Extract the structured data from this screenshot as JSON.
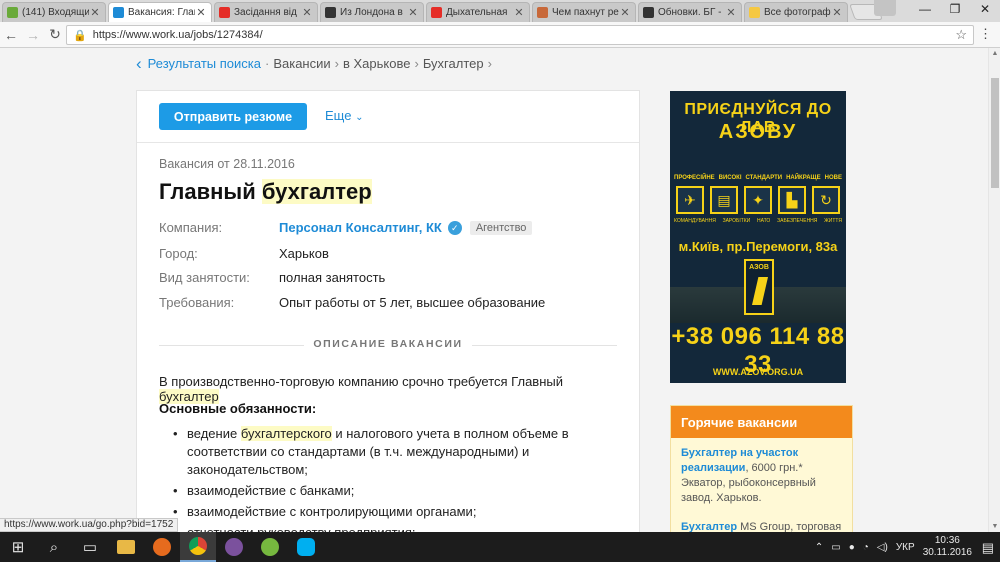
{
  "browser": {
    "tabs": [
      {
        "title": "(141) Входящи",
        "color": "#6aaa3a",
        "active": false
      },
      {
        "title": "Вакансия: Глав",
        "color": "#1e8bd6",
        "active": true
      },
      {
        "title": "Засідання від",
        "color": "#e52d27",
        "active": false
      },
      {
        "title": "Из Лондона в",
        "color": "#333333",
        "active": false
      },
      {
        "title": "Дыхательная",
        "color": "#e52d27",
        "active": false
      },
      {
        "title": "Чем пахнут ре",
        "color": "#c8693a",
        "active": false
      },
      {
        "title": "Обновки. БГ -",
        "color": "#333333",
        "active": false
      },
      {
        "title": "Все фотограф",
        "color": "#f5c842",
        "active": false
      }
    ],
    "url": "https://www.work.ua/jobs/1274384/"
  },
  "breadcrumb": {
    "items": [
      "Результаты поиска",
      "Вакансии",
      "в Харькове",
      "Бухгалтер"
    ]
  },
  "actions": {
    "send_resume": "Отправить резюме",
    "more": "Еще"
  },
  "vacancy": {
    "date": "Вакансия от 28.11.2016",
    "title_part1": "Главный ",
    "title_part2": "бухгалтер",
    "company_label": "Компания:",
    "company": "Персонал Консалтинг, КК",
    "agency_badge": "Агентство",
    "city_label": "Город:",
    "city": "Харьков",
    "employment_label": "Вид занятости:",
    "employment": "полная занятость",
    "requirements_label": "Требования:",
    "requirements": "Опыт работы от 5 лет, высшее образование",
    "section_title": "ОПИСАНИЕ ВАКАНСИИ",
    "intro_part1": "В производственно-торговую компанию срочно требуется Главный ",
    "intro_part2": "бухгалтер",
    "duties_title": "Основные обязанности:",
    "duty1_part1": "ведение ",
    "duty1_part2": "бухгалтерского",
    "duty1_part3": " и налогового учета в полном объеме в соответствии со стандартами (в т.ч. международными) и законодательством;",
    "duty2": "взаимодействие с банками;",
    "duty3": "взаимодействие с контролирующими органами;",
    "duty4": "отчетности руководству предприятия;"
  },
  "ad": {
    "line1": "ПРИЄДНУЙСЯ ДО ЛАВ",
    "line2": "АЗОВУ",
    "captions_top": [
      "ПРОФЕСІЙНЕ",
      "ВИСОКІ",
      "СТАНДАРТИ",
      "НАЙКРАЩЕ",
      "НОВЕ"
    ],
    "captions_bottom": [
      "КОМАНДУВАННЯ",
      "ЗАРОБІТКИ",
      "НАТО",
      "ЗАБЕЗПЕЧЕННЯ",
      "ЖИТТЯ"
    ],
    "address": "м.Київ, пр.Перемоги, 83а",
    "emblem": "АЗОВ",
    "phone": "+38 096 114 88 33",
    "site": "WWW.AZOV.ORG.UA"
  },
  "hot_vacancies": {
    "title": "Горячие вакансии",
    "item1_link": "Бухгалтер на участок реализации",
    "item1_text": ", 6000 грн.* Экватор, рыбоконсервный завод. Харьков.",
    "item2_link": "Бухгалтер",
    "item2_text": " MS Group, торговая"
  },
  "status_bar": "https://www.work.ua/go.php?bid=1752",
  "taskbar": {
    "lang": "УКР",
    "time": "10:36",
    "date": "30.11.2016"
  }
}
